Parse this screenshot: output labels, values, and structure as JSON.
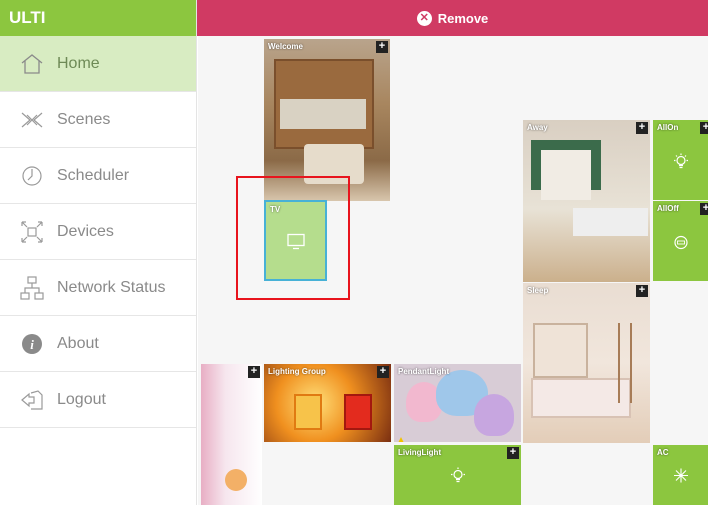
{
  "app": {
    "brand": "ULTI"
  },
  "topbar": {
    "remove_label": "Remove"
  },
  "sidebar": {
    "items": [
      {
        "label": "Home",
        "icon": "home-icon",
        "active": true
      },
      {
        "label": "Scenes",
        "icon": "scenes-icon",
        "active": false
      },
      {
        "label": "Scheduler",
        "icon": "clock-icon",
        "active": false
      },
      {
        "label": "Devices",
        "icon": "devices-icon",
        "active": false
      },
      {
        "label": "Network Status",
        "icon": "network-icon",
        "active": false
      },
      {
        "label": "About",
        "icon": "info-icon",
        "active": false
      },
      {
        "label": "Logout",
        "icon": "logout-icon",
        "active": false
      }
    ]
  },
  "tiles": {
    "welcome": {
      "label": "Welcome"
    },
    "tv": {
      "label": "TV"
    },
    "away": {
      "label": "Away"
    },
    "allon": {
      "label": "AllOn"
    },
    "alloff": {
      "label": "AllOff"
    },
    "sleep": {
      "label": "Sleep"
    },
    "lighting_group": {
      "label": "Lighting Group"
    },
    "pendant_light": {
      "label": "PendantLight"
    },
    "living_light": {
      "label": "LivingLight"
    },
    "ac": {
      "label": "AC"
    }
  },
  "colors": {
    "brand_green": "#8cc63f",
    "remove_bar": "#d03a63",
    "active_nav": "#d8ecc2",
    "highlight": "#e8141d"
  }
}
